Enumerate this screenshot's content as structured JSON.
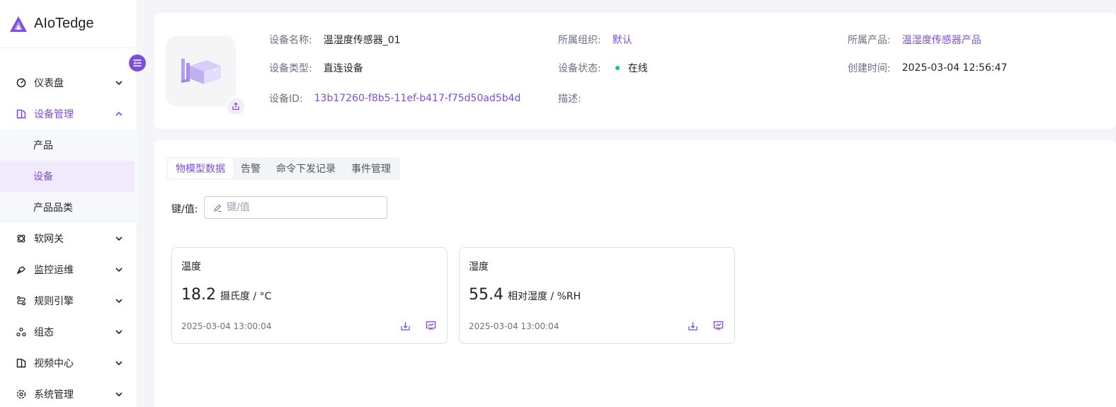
{
  "brand": {
    "name": "AIoTedge",
    "accent": "#7b4fd9"
  },
  "sidebar": {
    "items": [
      {
        "label": "仪表盘",
        "icon": "dashboard-icon"
      },
      {
        "label": "设备管理",
        "icon": "device-manage-icon",
        "expanded": true,
        "children": [
          {
            "label": "产品"
          },
          {
            "label": "设备",
            "active": true
          },
          {
            "label": "产品品类"
          }
        ]
      },
      {
        "label": "软网关",
        "icon": "gateway-icon"
      },
      {
        "label": "监控运维",
        "icon": "monitor-icon"
      },
      {
        "label": "规则引擎",
        "icon": "rule-engine-icon"
      },
      {
        "label": "组态",
        "icon": "config-icon"
      },
      {
        "label": "视频中心",
        "icon": "video-icon"
      },
      {
        "label": "系统管理",
        "icon": "settings-icon"
      }
    ]
  },
  "device": {
    "name_label": "设备名称:",
    "name": "温湿度传感器_01",
    "org_label": "所属组织:",
    "org": "默认",
    "product_label": "所属产品:",
    "product": "温湿度传感器产品",
    "type_label": "设备类型:",
    "type": "直连设备",
    "status_label": "设备状态:",
    "status": "在线",
    "status_color": "#10c98f",
    "created_label": "创建时间:",
    "created": "2025-03-04 12:56:47",
    "id_label": "设备ID:",
    "id": "13b17260-f8b5-11ef-b417-f75d50ad5b4d",
    "desc_label": "描述:",
    "desc": ""
  },
  "tabs": [
    {
      "label": "物模型数据",
      "active": true
    },
    {
      "label": "告警"
    },
    {
      "label": "命令下发记录"
    },
    {
      "label": "事件管理"
    }
  ],
  "filter": {
    "label": "键/值:",
    "placeholder": "键/值",
    "value": ""
  },
  "metrics": [
    {
      "name": "温度",
      "value": "18.2",
      "unit": "摄氏度 / °C",
      "time": "2025-03-04 13:00:04"
    },
    {
      "name": "湿度",
      "value": "55.4",
      "unit": "相对湿度 / %RH",
      "time": "2025-03-04 13:00:04"
    }
  ]
}
